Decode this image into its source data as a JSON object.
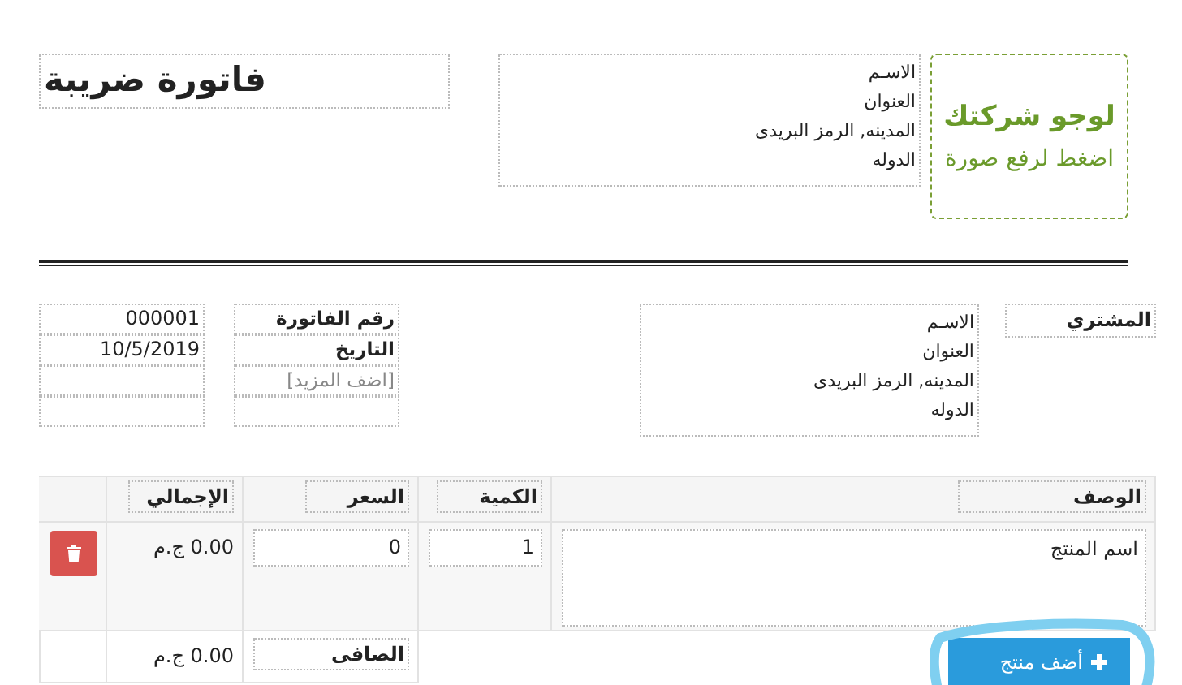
{
  "title": "فاتورة ضريبة",
  "company": {
    "logo_title": "لوجو شركتك",
    "logo_hint": "اضغط لرفع صورة",
    "address_lines": [
      "الاسـم",
      "العنوان",
      "المدينه, الرمز البريدى",
      "الدوله"
    ]
  },
  "buyer": {
    "label": "المشتري",
    "address_lines": [
      "الاسـم",
      "العنوان",
      "المدينه, الرمز البريدى",
      "الدوله"
    ]
  },
  "meta": [
    {
      "kind": "field",
      "label": "رقم الفاتورة",
      "value": "000001"
    },
    {
      "kind": "field",
      "label": "التاريخ",
      "value": "10/5/2019"
    },
    {
      "kind": "add_more",
      "label": "[اضف المزيد]"
    }
  ],
  "table": {
    "columns": [
      "الوصف",
      "الكمية",
      "السعر",
      "الإجمالي"
    ],
    "rows": [
      {
        "description": "اسم المنتج",
        "quantity": "1",
        "price": "0",
        "total": "0.00 ج.م"
      }
    ]
  },
  "totals": [
    {
      "label": "الصافى",
      "value": "0.00 ج.م"
    }
  ],
  "add_button": "أضف منتج"
}
